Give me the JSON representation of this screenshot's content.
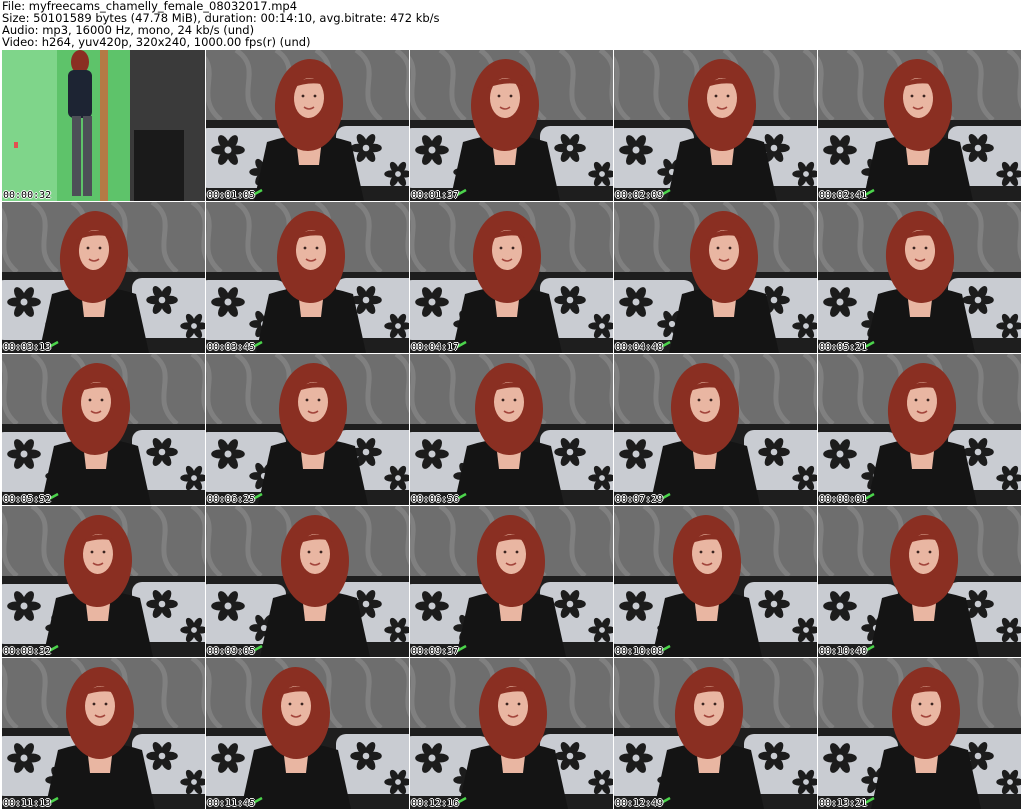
{
  "header": {
    "file_line": "File: myfreecams_chamelly_female_08032017.mp4",
    "size_line": "Size: 50101589 bytes (47.78 MiB), duration: 00:14:10, avg.bitrate: 472 kb/s",
    "audio_line": "Audio: mp3, 16000 Hz, mono, 24 kb/s (und)",
    "video_line": "Video: h264, yuv420p, 320x240, 1000.00 fps(r) (und)"
  },
  "thumbnails": [
    {
      "timestamp": "00:00:32",
      "scene": "doorway"
    },
    {
      "timestamp": "00:01:05",
      "scene": "couch"
    },
    {
      "timestamp": "00:01:37",
      "scene": "couch"
    },
    {
      "timestamp": "00:02:09",
      "scene": "couch"
    },
    {
      "timestamp": "00:02:41",
      "scene": "couch"
    },
    {
      "timestamp": "00:03:13",
      "scene": "couch"
    },
    {
      "timestamp": "00:03:45",
      "scene": "couch"
    },
    {
      "timestamp": "00:04:17",
      "scene": "couch"
    },
    {
      "timestamp": "00:04:48",
      "scene": "couch"
    },
    {
      "timestamp": "00:05:21",
      "scene": "couch"
    },
    {
      "timestamp": "00:05:52",
      "scene": "couch"
    },
    {
      "timestamp": "00:06:25",
      "scene": "couch"
    },
    {
      "timestamp": "00:06:56",
      "scene": "couch"
    },
    {
      "timestamp": "00:07:29",
      "scene": "couch"
    },
    {
      "timestamp": "00:08:01",
      "scene": "couch"
    },
    {
      "timestamp": "00:08:32",
      "scene": "couch"
    },
    {
      "timestamp": "00:09:05",
      "scene": "couch"
    },
    {
      "timestamp": "00:09:37",
      "scene": "couch"
    },
    {
      "timestamp": "00:10:08",
      "scene": "couch"
    },
    {
      "timestamp": "00:10:40",
      "scene": "couch"
    },
    {
      "timestamp": "00:11:13",
      "scene": "couch"
    },
    {
      "timestamp": "00:11:45",
      "scene": "couch"
    },
    {
      "timestamp": "00:12:16",
      "scene": "couch"
    },
    {
      "timestamp": "00:12:49",
      "scene": "couch"
    },
    {
      "timestamp": "00:13:21",
      "scene": "couch"
    }
  ],
  "colors": {
    "wallpaper": "#6e6e6e",
    "pillow": "#c9ccd2",
    "flower": "#1c1c1c",
    "hair": "#8a2f22",
    "skin": "#e9b6a2",
    "jacket": "#141414",
    "door_green": "#5ec36a"
  }
}
